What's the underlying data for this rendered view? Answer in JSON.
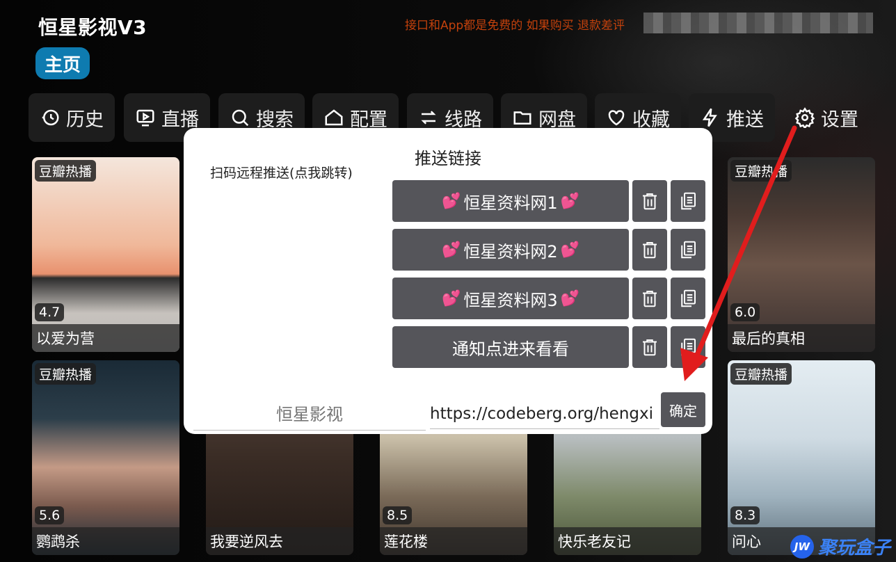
{
  "app": {
    "title": "恒星影视V3",
    "notice": "接口和App都是免费的 如果购买 退款差评",
    "home_tab": "主页"
  },
  "nav": [
    {
      "label": "历史",
      "icon": "history-icon"
    },
    {
      "label": "直播",
      "icon": "tv-icon"
    },
    {
      "label": "搜索",
      "icon": "search-icon"
    },
    {
      "label": "配置",
      "icon": "home-config-icon"
    },
    {
      "label": "线路",
      "icon": "switch-icon"
    },
    {
      "label": "网盘",
      "icon": "folder-icon"
    },
    {
      "label": "收藏",
      "icon": "heart-icon"
    },
    {
      "label": "推送",
      "icon": "lightning-icon"
    },
    {
      "label": "设置",
      "icon": "gear-icon"
    }
  ],
  "cards": [
    {
      "tag": "豆瓣热播",
      "rating": "4.7",
      "title": "以爱为营"
    },
    {
      "tag": "豆瓣热播",
      "rating": "6.0",
      "title": "最后的真相"
    },
    {
      "tag": "豆瓣热播",
      "rating": "5.6",
      "title": "鹦鹉杀"
    },
    {
      "tag": "",
      "rating": "",
      "title": "我要逆风去"
    },
    {
      "tag": "",
      "rating": "8.5",
      "title": "莲花楼"
    },
    {
      "tag": "",
      "rating": "",
      "title": "快乐老友记"
    },
    {
      "tag": "豆瓣热播",
      "rating": "8.3",
      "title": "问心"
    }
  ],
  "dialog": {
    "title": "推送链接",
    "qr_label": "扫码远程推送(点我跳转)",
    "links": [
      {
        "label": "恒星资料网1",
        "hearts": true
      },
      {
        "label": "恒星资料网2",
        "hearts": true
      },
      {
        "label": "恒星资料网3",
        "hearts": true
      },
      {
        "label": "通知点进来看看",
        "hearts": false
      }
    ],
    "name_placeholder": "恒星影视",
    "url_value": "https://codeberg.org/hengxi",
    "confirm_label": "确定"
  },
  "colors": {
    "accent": "#0e7bb0",
    "notice": "#c2410c",
    "button": "#55555a",
    "arrow": "#e11d1d"
  },
  "watermark": {
    "logo": "JW",
    "text": "聚玩盒子"
  }
}
